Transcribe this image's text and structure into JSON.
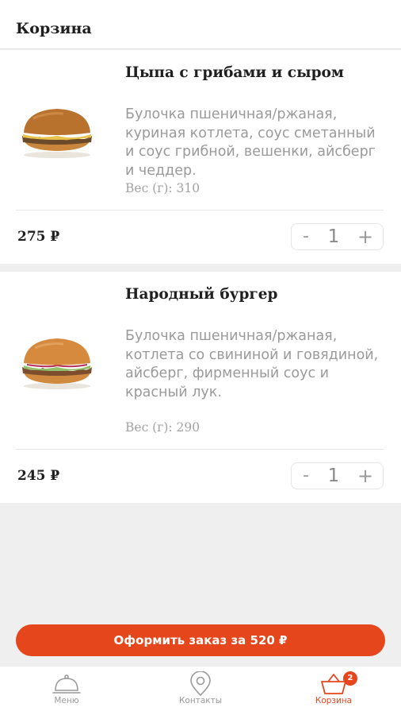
{
  "header": {
    "title": "Корзина"
  },
  "cart_items": [
    {
      "title": "Цыпа с грибами и сыром",
      "description": "Булочка пшеничная/ржаная, куриная котлета, соус сметанный и соус грибной, вешенки, айсберг и чеддер.",
      "weight": "Вес (г): 310",
      "price": "275 ₽",
      "quantity": "1",
      "minus_label": "-",
      "plus_label": "+"
    },
    {
      "title": "Народный бургер",
      "description": "Булочка пшеничная/ржаная, котлета со свининой и говядиной, айсберг, фирменный соус и красный лук.",
      "weight": "Вес (г): 290",
      "price": "245 ₽",
      "quantity": "1",
      "minus_label": "-",
      "plus_label": "+"
    }
  ],
  "checkout": {
    "label": "Оформить заказ за 520 ₽"
  },
  "tabbar": {
    "items": [
      {
        "label": "Меню",
        "icon": "cloche-icon"
      },
      {
        "label": "Контакты",
        "icon": "location-pin-icon"
      },
      {
        "label": "Корзина",
        "icon": "basket-icon",
        "badge": "2",
        "active": true
      }
    ]
  },
  "colors": {
    "accent": "#e6461c",
    "muted_text": "#9a9a9a",
    "text": "#1f1f1f",
    "background": "#efefef"
  }
}
